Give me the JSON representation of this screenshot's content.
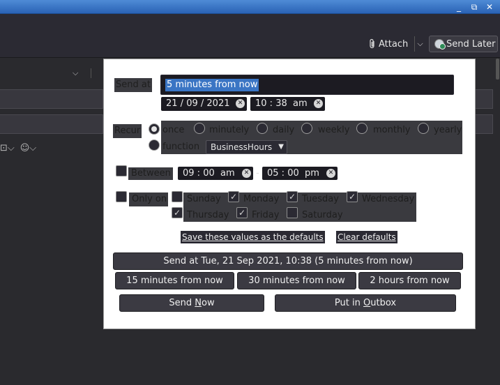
{
  "window": {
    "minimize": "_",
    "restore": "⧉",
    "close": "✕"
  },
  "toolbar": {
    "attach_label": "Attach",
    "send_later_label": "Send Later"
  },
  "popup": {
    "send_at_label": "Send at",
    "send_at_value": "5 minutes from now",
    "date": {
      "day": "21",
      "month": "09",
      "year": "2021"
    },
    "time": {
      "hour": "10",
      "minute": "38",
      "ampm": "am"
    },
    "recur_label": "Recur",
    "recur_options": [
      "once",
      "minutely",
      "daily",
      "weekly",
      "monthly",
      "yearly"
    ],
    "recur_selected": "once",
    "function_label": "function",
    "function_value": "BusinessHours",
    "between_label": "Between",
    "between_from": {
      "hour": "09",
      "minute": "00",
      "ampm": "am"
    },
    "between_sep": "-",
    "between_to": {
      "hour": "05",
      "minute": "00",
      "ampm": "pm"
    },
    "only_on_label": "Only on",
    "days": [
      {
        "name": "Sunday",
        "checked": false
      },
      {
        "name": "Monday",
        "checked": true
      },
      {
        "name": "Tuesday",
        "checked": true
      },
      {
        "name": "Wednesday",
        "checked": true
      },
      {
        "name": "Thursday",
        "checked": true
      },
      {
        "name": "Friday",
        "checked": true
      },
      {
        "name": "Saturday",
        "checked": false
      }
    ],
    "save_defaults": "Save these values as the defaults",
    "clear_defaults": "Clear defaults",
    "send_at_button": "Send at Tue, 21 Sep 2021, 10:38 (5 minutes from now)",
    "quick": [
      "15 minutes from now",
      "30 minutes from now",
      "2 hours from now"
    ],
    "send_now_prefix": "Send ",
    "send_now_ul": "N",
    "send_now_suffix": "ow",
    "outbox_prefix": "Put in ",
    "outbox_ul": "O",
    "outbox_suffix": "utbox"
  }
}
